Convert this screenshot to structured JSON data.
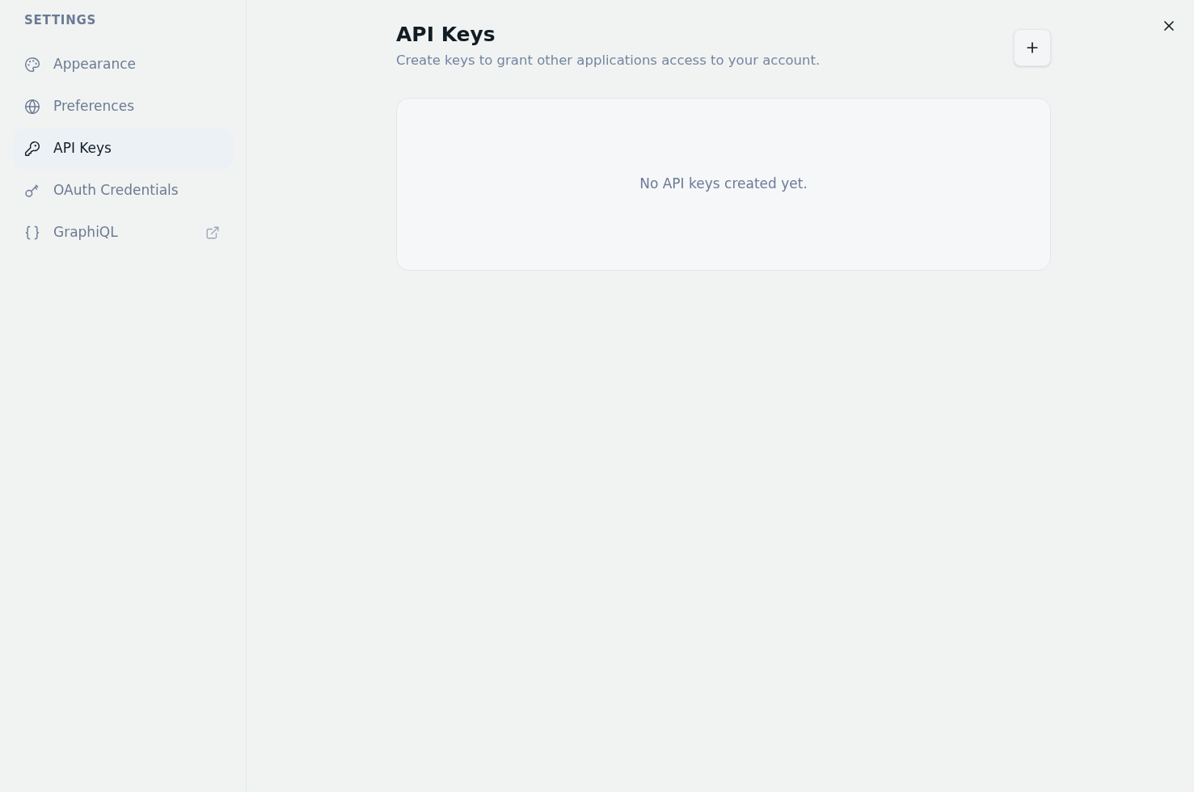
{
  "sidebar": {
    "heading": "SETTINGS",
    "items": [
      {
        "label": "Appearance",
        "selected": false,
        "external": false
      },
      {
        "label": "Preferences",
        "selected": false,
        "external": false
      },
      {
        "label": "API Keys",
        "selected": true,
        "external": false
      },
      {
        "label": "OAuth Credentials",
        "selected": false,
        "external": false
      },
      {
        "label": "GraphiQL",
        "selected": false,
        "external": true
      }
    ]
  },
  "page": {
    "title": "API Keys",
    "description": "Create keys to grant other applications access to your account."
  },
  "api_keys": {
    "empty_message": "No API keys created yet."
  }
}
